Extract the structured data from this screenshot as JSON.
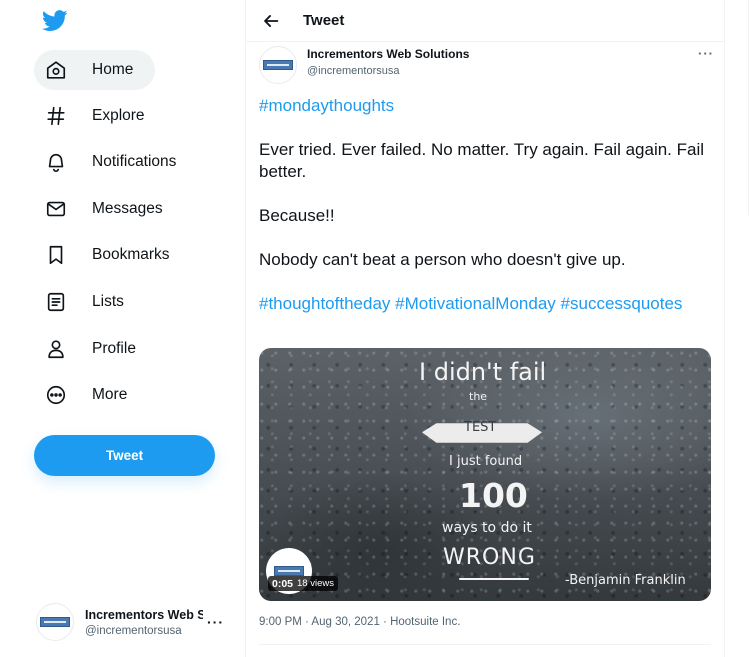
{
  "nav": {
    "items": [
      {
        "label": "Home",
        "icon": "home-icon"
      },
      {
        "label": "Explore",
        "icon": "hashtag-icon"
      },
      {
        "label": "Notifications",
        "icon": "bell-icon"
      },
      {
        "label": "Messages",
        "icon": "mail-icon"
      },
      {
        "label": "Bookmarks",
        "icon": "bookmark-icon"
      },
      {
        "label": "Lists",
        "icon": "list-icon"
      },
      {
        "label": "Profile",
        "icon": "person-icon"
      },
      {
        "label": "More",
        "icon": "more-circle-icon"
      }
    ],
    "tweet_button": "Tweet"
  },
  "account": {
    "name": "Incrementors Web Solutions",
    "handle": "@incrementorsusa",
    "more": "···"
  },
  "header": {
    "title": "Tweet"
  },
  "tweet": {
    "author_name": "Incrementors Web Solutions",
    "author_handle": "@incrementorsusa",
    "more": "···",
    "hashtag_top": "#mondaythoughts",
    "line1": "Ever tried. Ever failed. No matter. Try again. Fail again. Fail better.",
    "line2": "Because!!",
    "line3": "Nobody can't beat a person who doesn't give up.",
    "hashtags": [
      "#thoughtoftheday",
      "#MotivationalMonday",
      "#successquotes"
    ],
    "media": {
      "quote": [
        "I didn't fail",
        "the",
        "TEST",
        "I just found",
        "100",
        "ways to do it",
        "WRONG",
        "-Benjamin Franklin"
      ],
      "duration": "0:05",
      "views": "18 views"
    },
    "meta": {
      "time": "9:00 PM",
      "date": "Aug 30, 2021",
      "source": "Hootsuite Inc.",
      "separator": " · "
    }
  },
  "colors": {
    "accent": "#1d9bf0",
    "text": "#0f1419",
    "muted": "#536471",
    "active_bg": "#eff3f4"
  }
}
